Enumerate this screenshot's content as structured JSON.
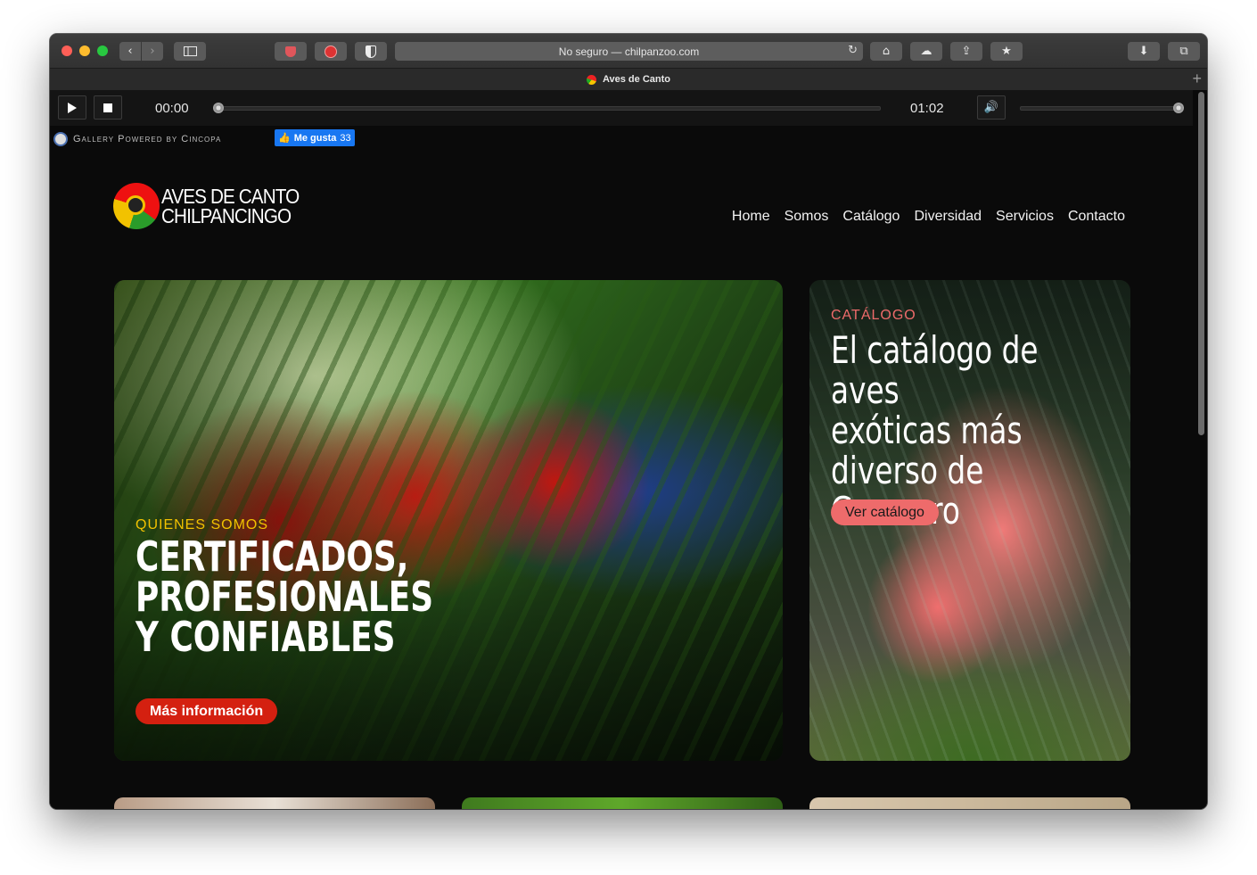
{
  "browser": {
    "url_text": "No seguro — chilpanzoo.com",
    "tab_title": "Aves de Canto",
    "buttons": {
      "back": "‹",
      "forward": "›",
      "reload": "↻",
      "new_tab": "+"
    }
  },
  "player": {
    "current_time": "00:00",
    "duration": "01:02",
    "progress": 0.0,
    "volume": 1.0,
    "gallery_credit": "Gallery Powered by Cincopa",
    "like_label": "Me gusta",
    "like_count": "33"
  },
  "site": {
    "logo_line1": "AVES DE CANTO",
    "logo_line2": "CHILPANCINGO",
    "nav": [
      "Home",
      "Somos",
      "Catálogo",
      "Diversidad",
      "Servicios",
      "Contacto"
    ]
  },
  "hero_main": {
    "kicker": "QUIENES SOMOS",
    "title_line1": "CERTIFICADOS,",
    "title_line2": "PROFESIONALES",
    "title_line3": "Y CONFIABLES",
    "button": "Más información"
  },
  "hero_side": {
    "kicker": "CATÁLOGO",
    "title_line1": "El catálogo de aves",
    "title_line2": "exóticas más",
    "title_line3": "diverso de Guerrero",
    "button": "Ver catálogo"
  },
  "colors": {
    "kicker_main": "#f2c200",
    "kicker_side": "#ee6b6b",
    "button_main": "#d42010",
    "button_side": "#ee6b6b"
  }
}
